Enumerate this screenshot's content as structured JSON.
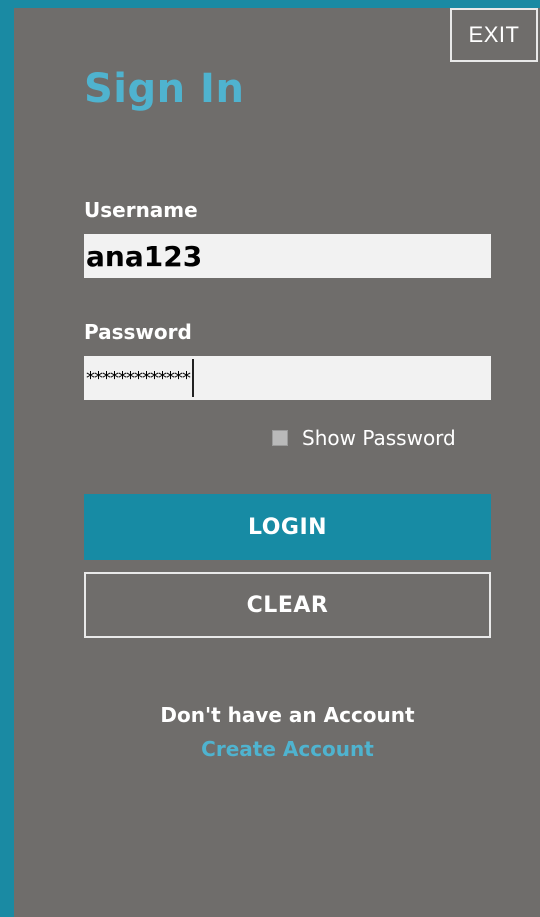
{
  "window": {
    "exit_label": "EXIT"
  },
  "form": {
    "title": "Sign In",
    "username_label": "Username",
    "username_value": "ana123",
    "password_label": "Password",
    "password_masked": "*************",
    "show_password_label": "Show Password",
    "show_password_checked": false,
    "login_label": "LOGIN",
    "clear_label": "CLEAR"
  },
  "footer": {
    "no_account_text": "Don't have an Account",
    "create_account_label": "Create Account"
  },
  "colors": {
    "frame": "#1a8aa3",
    "panel": "#6f6d6b",
    "accent": "#4fb3cf",
    "login_button": "#178ba4",
    "input_bg": "#f2f2f2"
  }
}
